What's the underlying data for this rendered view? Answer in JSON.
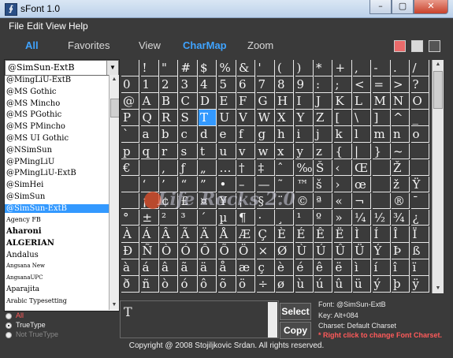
{
  "window": {
    "title": "sFont 1.0",
    "app_icon": "sfont-icon",
    "minimize": "–",
    "maximize": "▢",
    "close": "✕"
  },
  "menu": [
    "File",
    "Edit",
    "View",
    "Help"
  ],
  "tabs": [
    "All",
    "Favorites",
    "View",
    "CharMap",
    "Zoom"
  ],
  "active_tab": 3,
  "swatches": [
    "#e96a6a",
    "#d9d9d9",
    "#555555"
  ],
  "font_combo": {
    "value": "@SimSun-ExtB",
    "arrow": "▼"
  },
  "font_list": [
    {
      "label": "@MingLiU-ExtB",
      "size": 10
    },
    {
      "label": "@MS Gothic",
      "size": 10
    },
    {
      "label": "@MS Mincho",
      "size": 10
    },
    {
      "label": "@MS PGothic",
      "size": 10
    },
    {
      "label": "@MS PMincho",
      "size": 10
    },
    {
      "label": "@MS UI Gothic",
      "size": 10
    },
    {
      "label": "@NSimSun",
      "size": 10
    },
    {
      "label": "@PMingLiU",
      "size": 10
    },
    {
      "label": "@PMingLiU-ExtB",
      "size": 10
    },
    {
      "label": "@SimHei",
      "size": 10
    },
    {
      "label": "@SimSun",
      "size": 10
    },
    {
      "label": "@SimSun-ExtB",
      "size": 10,
      "selected": true
    },
    {
      "label": "Agency FB",
      "size": 8
    },
    {
      "label": "Aharoni",
      "size": 10,
      "bold": true
    },
    {
      "label": "ALGERIAN",
      "size": 10,
      "bold": true
    },
    {
      "label": "Andalus",
      "size": 10
    },
    {
      "label": "Angsana New",
      "size": 7
    },
    {
      "label": "AngsanaUPC",
      "size": 7
    },
    {
      "label": "Aparajita",
      "size": 9
    },
    {
      "label": "Arabic Typesetting",
      "size": 8
    }
  ],
  "radios": [
    {
      "label": "All",
      "color": "#ff5a5a",
      "checked": false
    },
    {
      "label": "TrueType",
      "color": "#f0f0f0",
      "checked": true
    },
    {
      "label": "Not TrueType",
      "color": "#888888",
      "checked": false
    }
  ],
  "charmap": {
    "selected": "T",
    "rows": [
      " !\"#$%&'()*+,-./",
      "0123456789:;<=>?",
      "@ABCDEFGHIJKLMNO",
      "PQRSTUVWXYZ[\\]^_",
      "`abcdefghijklmno",
      "pqrstuvwxyz{|}~ ",
      "€ ‚ƒ„…†‡ˆ‰Š‹Œ Ž ",
      " ‘’“”•–—˜™š›œ žŸ",
      " ¡¢£¤¥¦§¨©ª«¬­®¯",
      "°±²³´µ¶·¸¹º»¼½¾¿",
      "ÀÁÂÃÄÅÆÇÈÉÊËÌÍÎÏ",
      "ÐÑÒÓÔÕÖ×ØÙÚÛÜÝÞß",
      "àáâãäåæçèéêëìíîï",
      "ðñòóôõö÷øùúûüýþÿ"
    ]
  },
  "watermark": "Life Rocks 2.0",
  "preview": {
    "text": "T"
  },
  "buttons": {
    "select": "Select",
    "copy": "Copy"
  },
  "info": {
    "font": "Font: @SimSun-ExtB",
    "key": "Key: Alt+084",
    "charset": "Charset: Default Charset",
    "hint": "* Right click to change Font Charset."
  },
  "footer": "Copyright @ 2008 Stojiljkovic Srdan. All rights reserved."
}
